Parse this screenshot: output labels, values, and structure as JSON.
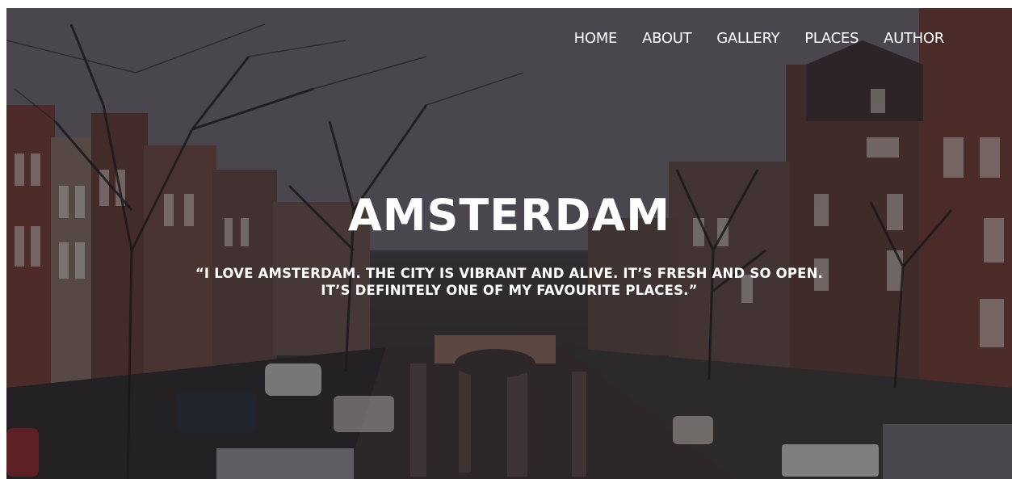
{
  "nav": {
    "items": [
      {
        "label": "HOME"
      },
      {
        "label": "ABOUT"
      },
      {
        "label": "GALLERY"
      },
      {
        "label": "PLACES"
      },
      {
        "label": "AUTHOR"
      }
    ]
  },
  "hero": {
    "title": "AMSTERDAM",
    "quote_line1": "“I LOVE AMSTERDAM. THE CITY IS VIBRANT AND ALIVE. IT’S FRESH AND SO OPEN.",
    "quote_line2": "IT’S DEFINITELY ONE OF MY FAVOURITE PLACES.”"
  },
  "colors": {
    "text": "#ffffff",
    "overlay": "#141218",
    "brick": "#6e3b32",
    "water": "#3d3436"
  }
}
